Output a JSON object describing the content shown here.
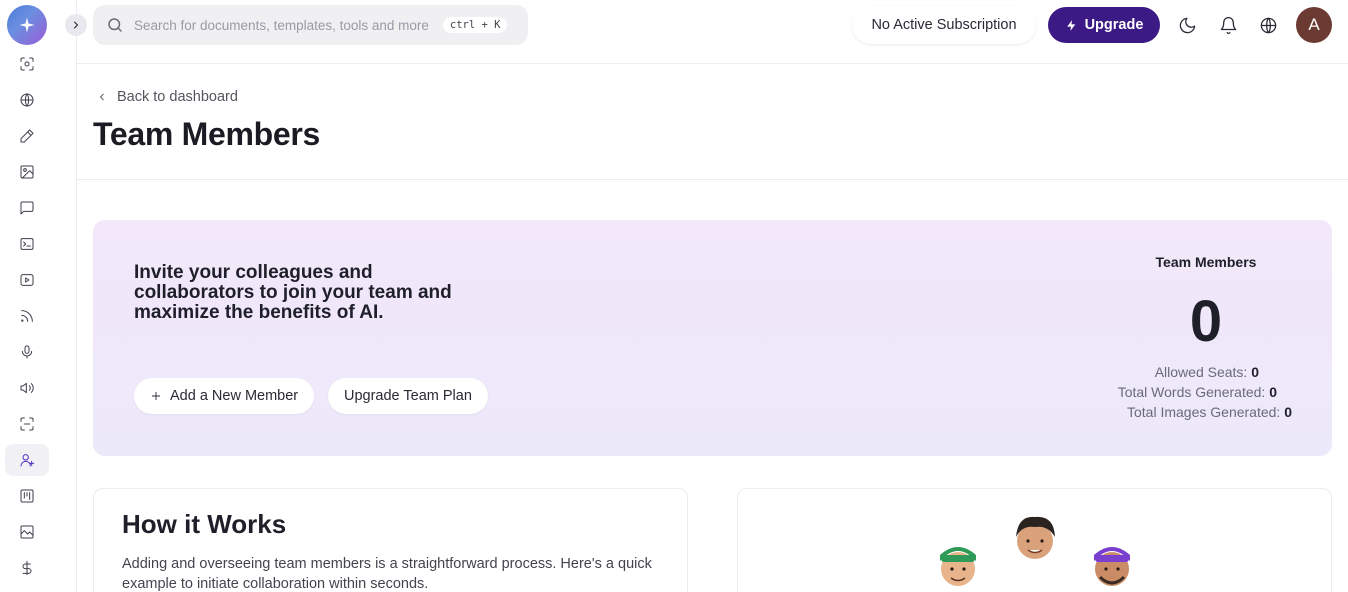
{
  "sidebar": {
    "items": [
      {
        "icon": "scan-face-icon"
      },
      {
        "icon": "www-globe-icon"
      },
      {
        "icon": "pen-icon"
      },
      {
        "icon": "image-icon"
      },
      {
        "icon": "chat-bubble-icon"
      },
      {
        "icon": "terminal-icon"
      },
      {
        "icon": "video-play-icon"
      },
      {
        "icon": "rss-icon"
      },
      {
        "icon": "microphone-icon"
      },
      {
        "icon": "speaker-icon"
      },
      {
        "icon": "scan-icon"
      },
      {
        "icon": "user-plus-icon",
        "active": true
      },
      {
        "icon": "kanban-icon"
      },
      {
        "icon": "gallery-icon"
      },
      {
        "icon": "dollar-icon"
      }
    ]
  },
  "header": {
    "search_placeholder": "Search for documents, templates, tools and more",
    "search_shortcut": "ctrl + K",
    "subscription_status": "No Active Subscription",
    "upgrade_label": "Upgrade",
    "avatar_initial": "A"
  },
  "page": {
    "back_label": "Back to dashboard",
    "title": "Team Members"
  },
  "hero": {
    "invite_text": "Invite your colleagues and collaborators to join your team and maximize the benefits of AI.",
    "add_member_label": "Add a New Member",
    "upgrade_plan_label": "Upgrade Team Plan",
    "stats_title": "Team Members",
    "member_count": "0",
    "allowed_seats_label": "Allowed Seats:",
    "allowed_seats_value": "0",
    "words_label": "Total Words Generated:",
    "words_value": "0",
    "images_label": "Total Images Generated:",
    "images_value": "0"
  },
  "how_it_works": {
    "title": "How it Works",
    "description": "Adding and overseeing team members is a straightforward process. Here's a quick example to initiate collaboration within seconds."
  },
  "colors": {
    "accent": "#3c1a86",
    "hero_bg": "#efe8fa",
    "avatar_bg": "#6b3a33"
  }
}
